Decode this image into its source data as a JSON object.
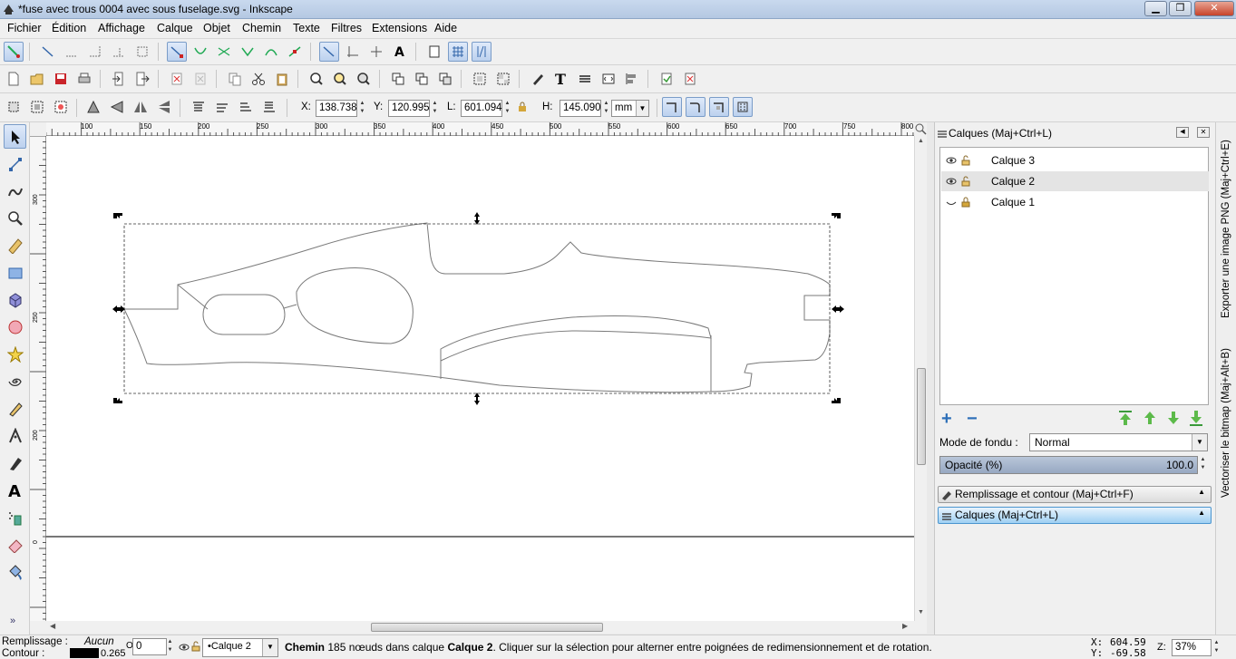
{
  "window": {
    "title": "*fuse avec trous  0004  avec sous fuselage.svg - Inkscape",
    "minimize": "▁",
    "maximize": "❐",
    "close": "✕"
  },
  "menu": [
    "Fichier",
    "Édition",
    "Affichage",
    "Calque",
    "Objet",
    "Chemin",
    "Texte",
    "Filtres",
    "Extensions",
    "Aide"
  ],
  "selectbar": {
    "x_label": "X:",
    "x": "138.738",
    "y_label": "Y:",
    "y": "120.995",
    "w_label": "L:",
    "w": "601.094",
    "h_label": "H:",
    "h": "145.090",
    "unit": "mm"
  },
  "rulers": {
    "top": [
      "100",
      "150",
      "200",
      "250",
      "300",
      "350",
      "400",
      "450",
      "500",
      "550",
      "600",
      "650",
      "700",
      "750",
      "800"
    ],
    "left": [
      "300",
      "250",
      "200",
      "150",
      "0"
    ]
  },
  "dock": {
    "title": "Calques (Maj+Ctrl+L)",
    "layers": [
      {
        "name": "Calque 3",
        "visible": true,
        "locked": false,
        "selected": false
      },
      {
        "name": "Calque 2",
        "visible": true,
        "locked": false,
        "selected": true
      },
      {
        "name": "Calque 1",
        "visible": false,
        "locked": true,
        "selected": false
      }
    ],
    "blend_label": "Mode de fondu :",
    "blend_value": "Normal",
    "opacity_label": "Opacité (%)",
    "opacity_value": "100.0",
    "opacity_fraction": 1.0,
    "panels": [
      {
        "label": "Remplissage et contour (Maj+Ctrl+F)",
        "active": false
      },
      {
        "label": "Calques (Maj+Ctrl+L)",
        "active": true
      }
    ]
  },
  "sidetabs": [
    "Exporter une image PNG (Maj+Ctrl+E)",
    "Vectoriser le bitmap (Maj+Alt+B)"
  ],
  "status": {
    "fill_label": "Remplissage :",
    "fill_value": "Aucun",
    "stroke_label": "Contour :",
    "stroke_width": "0.265",
    "opacity_short": "0",
    "layer": "•Calque 2",
    "msg_bold1": "Chemin",
    "msg1": " 185 nœuds dans calque ",
    "msg_bold2": "Calque 2",
    "msg2": ". Cliquer sur la sélection pour alterner entre poignées de redimensionnement et de rotation.",
    "x_label": "X:",
    "x": "604.59",
    "y_label": "Y:",
    "y": "-69.58",
    "z_label": "Z:",
    "zoom": "37%"
  },
  "colors": {
    "accent": "#3a8fdf",
    "selected_tool": "#bcd1ee",
    "canvas": "#ffffff",
    "titlebar": "#c2d4eb"
  }
}
